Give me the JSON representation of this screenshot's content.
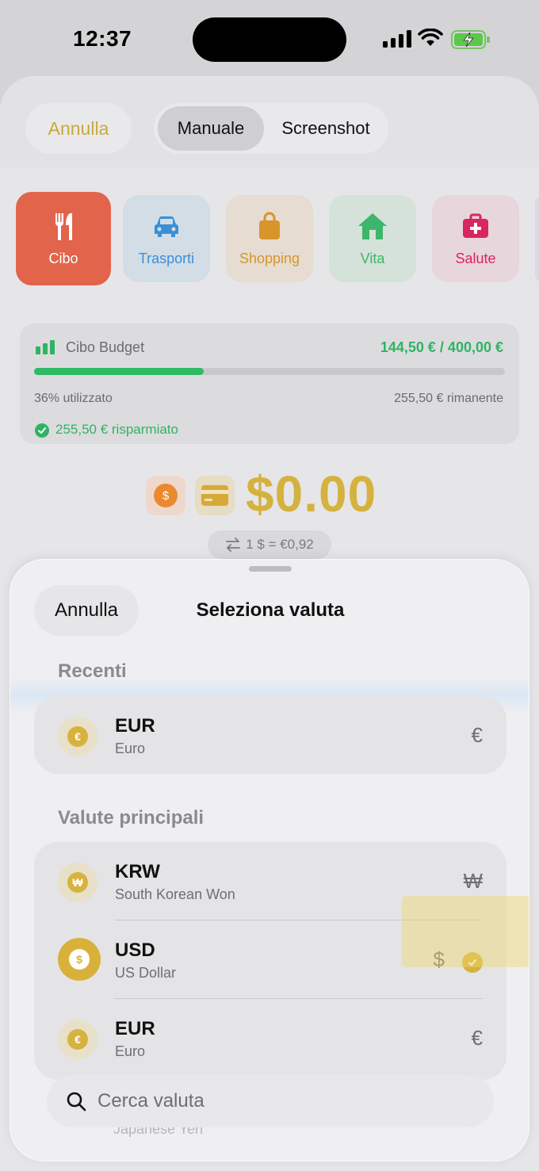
{
  "status_bar": {
    "time": "12:37"
  },
  "top_sheet": {
    "cancel_label": "Annulla",
    "segments": [
      "Manuale",
      "Screenshot"
    ],
    "categories": [
      "Cibo",
      "Trasporti",
      "Shopping",
      "Vita",
      "Salute"
    ],
    "budget": {
      "title": "Cibo Budget",
      "amount": "144,50 € / 400,00 €",
      "used_label": "36% utilizzato",
      "used_fraction": 0.36,
      "remaining_label": "255,50 € rimanente",
      "saved_label": "255,50 € risparmiato"
    },
    "amount_display": "$0.00",
    "rate_label": "1 $ = €0,92"
  },
  "currency_sheet": {
    "cancel_label": "Annulla",
    "title": "Seleziona valuta",
    "recent_label": "Recenti",
    "recent": [
      {
        "code": "EUR",
        "name": "Euro",
        "symbol": "€"
      }
    ],
    "main_label": "Valute principali",
    "main": [
      {
        "code": "KRW",
        "name": "South Korean Won",
        "symbol": "₩"
      },
      {
        "code": "USD",
        "name": "US Dollar",
        "symbol": "$",
        "selected": true
      },
      {
        "code": "EUR",
        "name": "Euro",
        "symbol": "€"
      }
    ],
    "search_placeholder": "Cerca valuta",
    "partial_row_name": "Japanese Yen"
  },
  "colors": {
    "accent": "#d5b23f",
    "budget_green": "#2fb463",
    "cibo": "#e2644b"
  }
}
